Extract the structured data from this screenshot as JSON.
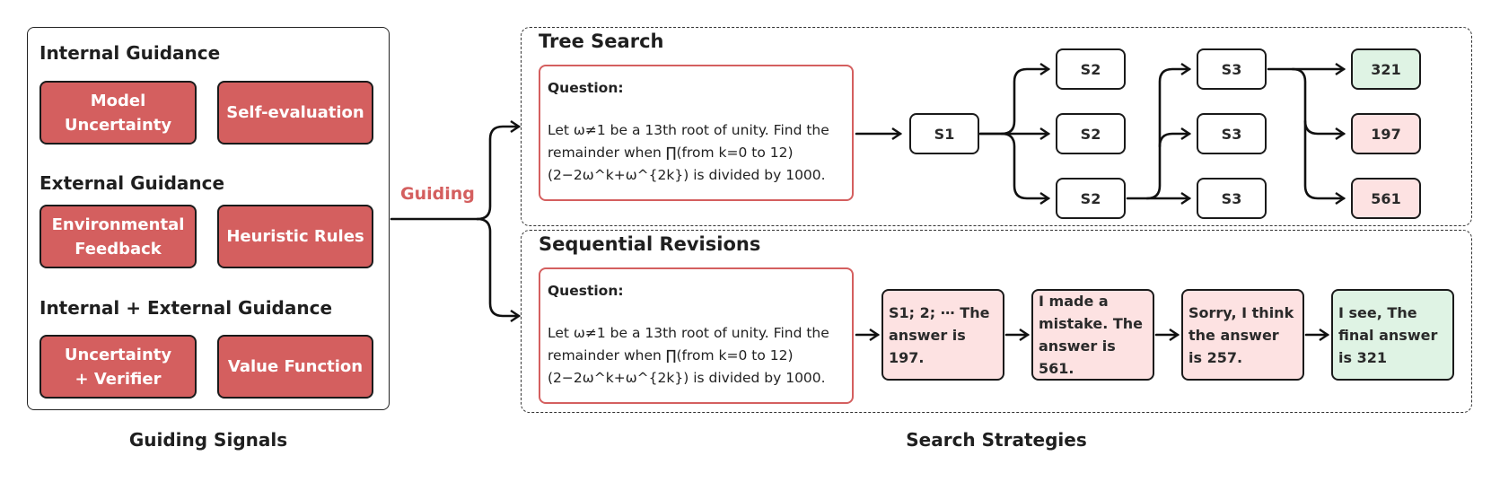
{
  "guiding_signals": {
    "caption": "Guiding Signals",
    "groups": [
      {
        "title": "Internal Guidance",
        "items": [
          "Model\nUncertainty",
          "Self-evaluation"
        ]
      },
      {
        "title": "External Guidance",
        "items": [
          "Environmental\nFeedback",
          "Heuristic Rules"
        ]
      },
      {
        "title": "Internal + External Guidance",
        "items": [
          "Uncertainty\n+ Verifier",
          "Value Function"
        ]
      }
    ]
  },
  "connector_label": "Guiding",
  "search_strategies": {
    "caption": "Search Strategies",
    "tree_search": {
      "title": "Tree Search",
      "question_label": "Question:",
      "question_text": "Let ω≠1 be a 13th root of unity. Find the remainder when ∏(from k=0 to 12) (2−2ω^k+ω^{2k}) is divided by 1000.",
      "root": "S1",
      "level2": [
        "S2",
        "S2",
        "S2"
      ],
      "level3": [
        "S3",
        "S3",
        "S3"
      ],
      "answers": [
        {
          "value": "321",
          "status": "correct"
        },
        {
          "value": "197",
          "status": "incorrect"
        },
        {
          "value": "561",
          "status": "incorrect"
        }
      ]
    },
    "sequential_revisions": {
      "title": "Sequential Revisions",
      "question_label": "Question:",
      "question_text": "Let ω≠1 be a 13th root of unity. Find the remainder when ∏(from k=0 to 12) (2−2ω^k+ω^{2k}) is divided by 1000.",
      "steps": [
        {
          "text": "S1; 2; ⋯ The answer is 197.",
          "status": "incorrect"
        },
        {
          "text": "I made a mistake. The answer is 561.",
          "status": "incorrect"
        },
        {
          "text": "Sorry, I think the answer is 257.",
          "status": "incorrect"
        },
        {
          "text": "I see, The final answer is 321",
          "status": "correct"
        }
      ]
    }
  },
  "colors": {
    "signal_fill": "#d45f5f",
    "correct_fill": "#dff3e4",
    "incorrect_fill": "#fde2e2",
    "question_border": "#d45f5f"
  }
}
